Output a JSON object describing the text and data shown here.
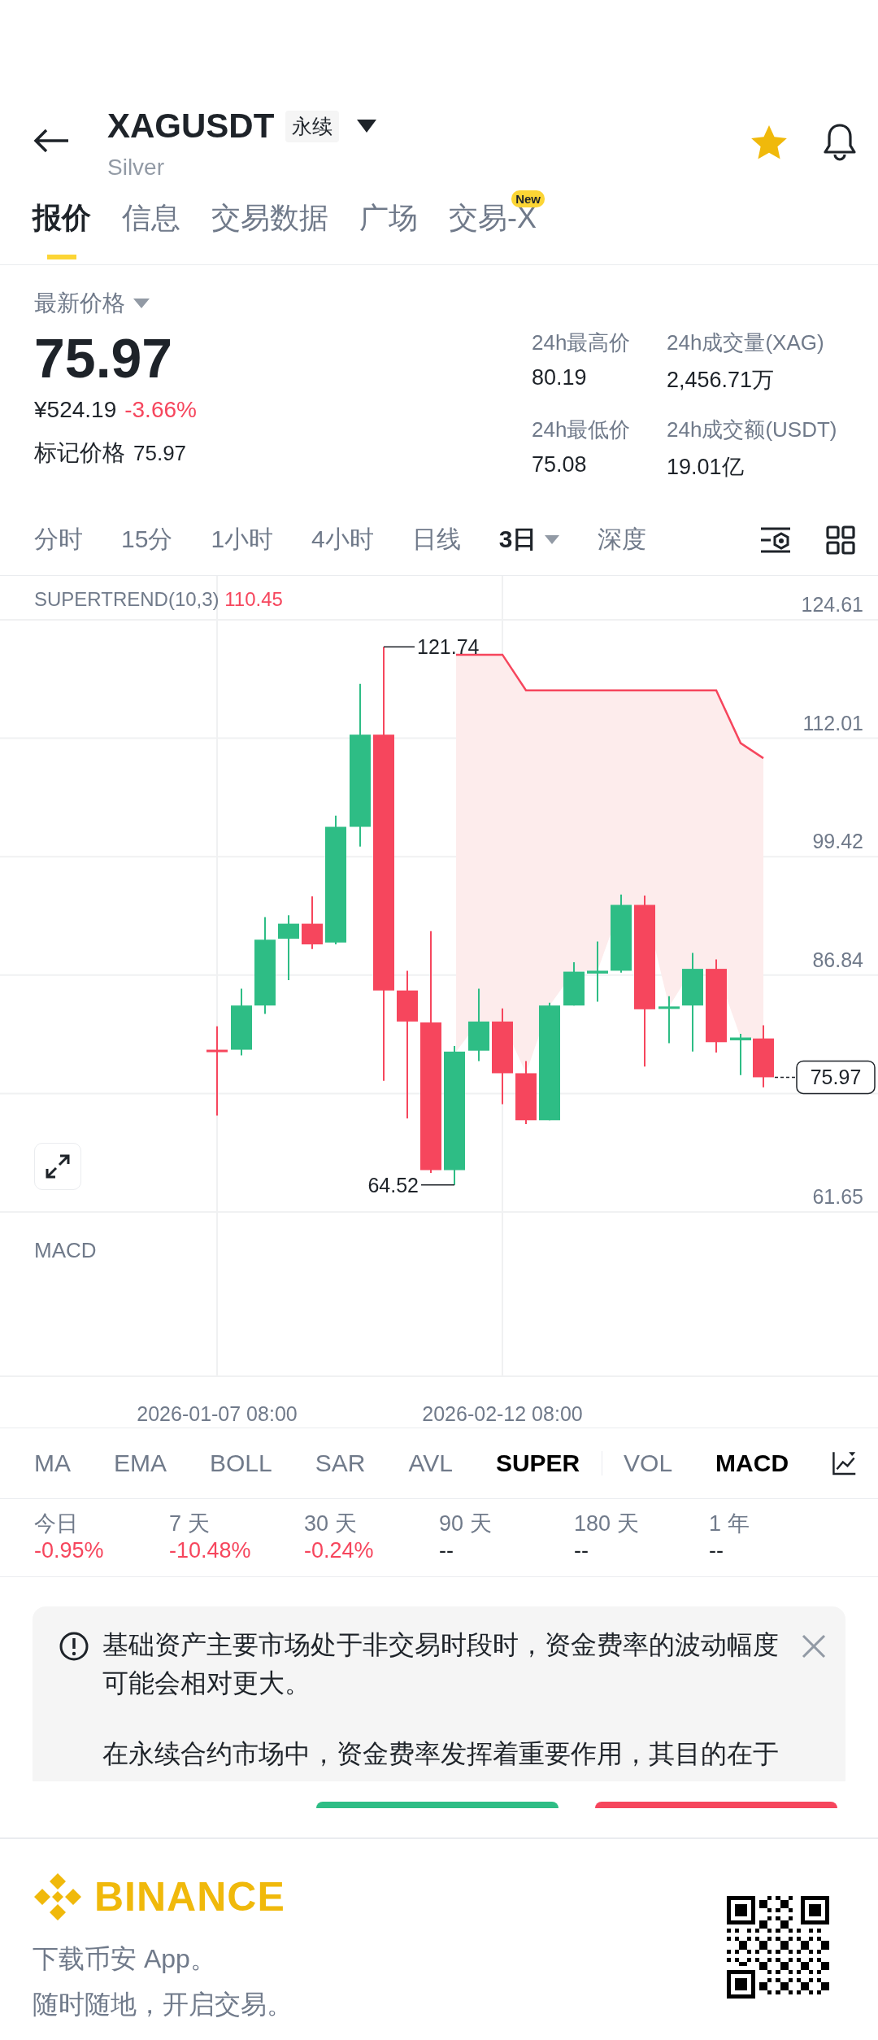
{
  "header": {
    "symbol": "XAGUSDT",
    "contract_badge": "永续",
    "name": "Silver",
    "favorite": true
  },
  "tabs": [
    {
      "label": "报价",
      "selected": true
    },
    {
      "label": "信息",
      "selected": false
    },
    {
      "label": "交易数据",
      "selected": false
    },
    {
      "label": "广场",
      "selected": false
    },
    {
      "label": "交易-X",
      "selected": false,
      "badge": "New"
    }
  ],
  "price": {
    "label": "最新价格",
    "last": "75.97",
    "fiat": "¥524.19",
    "change": "-3.66%",
    "mark_label": "标记价格",
    "mark_value": "75.97"
  },
  "stats": [
    {
      "label": "24h最高价",
      "value": "80.19"
    },
    {
      "label": "24h成交量(XAG)",
      "value": "2,456.71万"
    },
    {
      "label": "24h最低价",
      "value": "75.08"
    },
    {
      "label": "24h成交额(USDT)",
      "value": "19.01亿"
    }
  ],
  "intervals": [
    {
      "label": "分时",
      "selected": false,
      "has_menu": false
    },
    {
      "label": "15分",
      "selected": false,
      "has_menu": false
    },
    {
      "label": "1小时",
      "selected": false,
      "has_menu": false
    },
    {
      "label": "4小时",
      "selected": false,
      "has_menu": false
    },
    {
      "label": "日线",
      "selected": false,
      "has_menu": false
    },
    {
      "label": "3日",
      "selected": true,
      "has_menu": true
    },
    {
      "label": "深度",
      "selected": false,
      "has_menu": false
    }
  ],
  "chart": {
    "indicator_name": "SUPERTREND(10,3)",
    "indicator_value": "110.45",
    "y_labels": [
      "124.61",
      "112.01",
      "99.42",
      "86.84",
      "61.65"
    ],
    "high_label": "121.74",
    "low_label": "64.52",
    "last_price": "75.97",
    "sub_indicator": "MACD",
    "dates": [
      "2026-01-07 08:00",
      "2026-02-12 08:00"
    ]
  },
  "indicators": {
    "main": [
      {
        "label": "MA",
        "selected": false
      },
      {
        "label": "EMA",
        "selected": false
      },
      {
        "label": "BOLL",
        "selected": false
      },
      {
        "label": "SAR",
        "selected": false
      },
      {
        "label": "AVL",
        "selected": false
      },
      {
        "label": "SUPER",
        "selected": true
      }
    ],
    "sub": [
      {
        "label": "VOL",
        "selected": false
      },
      {
        "label": "MACD",
        "selected": true
      }
    ]
  },
  "periods": [
    {
      "label": "今日",
      "value": "-0.95%",
      "color": "#f6465d"
    },
    {
      "label": "7 天",
      "value": "-10.48%",
      "color": "#f6465d"
    },
    {
      "label": "30 天",
      "value": "-0.24%",
      "color": "#f6465d"
    },
    {
      "label": "90 天",
      "value": "--",
      "color": "#1e2329"
    },
    {
      "label": "180 天",
      "value": "--",
      "color": "#1e2329"
    },
    {
      "label": "1 年",
      "value": "--",
      "color": "#1e2329"
    }
  ],
  "notice": {
    "paragraphs": [
      "基础资产主要市场处于非交易时段时，资金费率的波动幅度可能会相对更大。",
      "在永续合约市场中，资金费率发挥着重要作用，其目的在于"
    ]
  },
  "footer": {
    "brand": "BINANCE",
    "lines": [
      "下载币安 App。",
      "随时随地，开启交易。"
    ]
  }
}
